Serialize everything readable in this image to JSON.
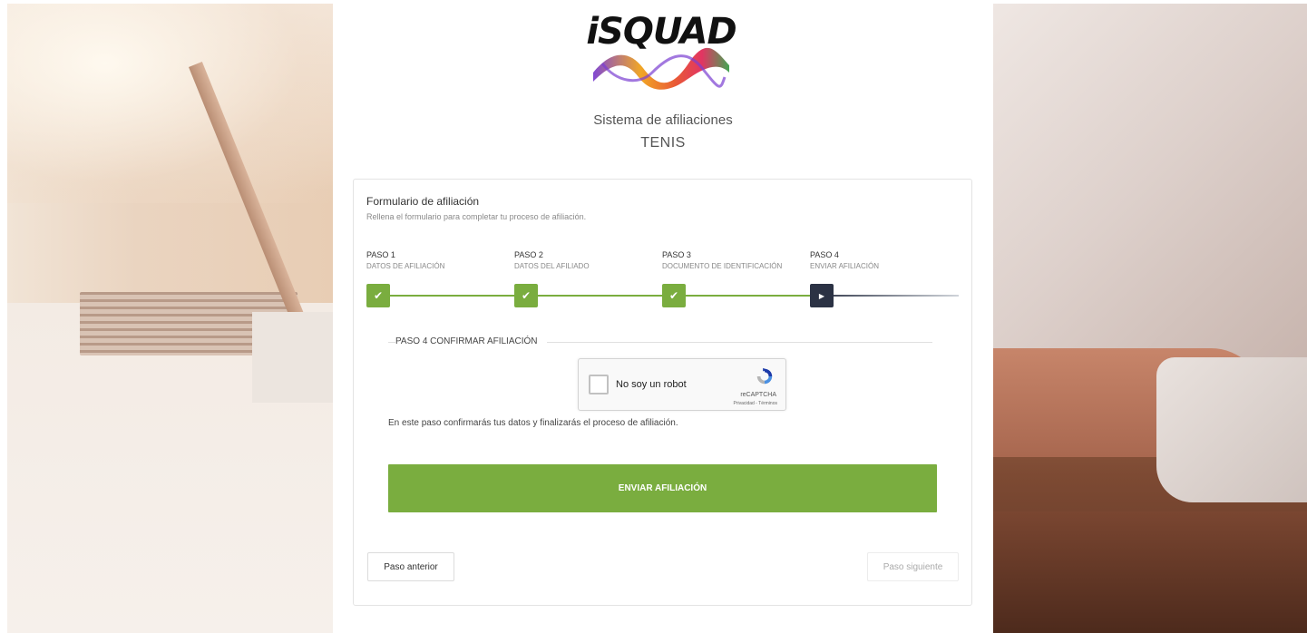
{
  "brand": {
    "logo_text": "iSQUAD"
  },
  "header": {
    "system_title": "Sistema de afiliaciones",
    "sport": "TENIS"
  },
  "form": {
    "title": "Formulario de afiliación",
    "subtitle": "Rellena el formulario para completar tu proceso de afiliación."
  },
  "steps": [
    {
      "number": "PASO 1",
      "name": "DATOS DE AFILIACIÓN",
      "status": "done",
      "icon": "check-icon"
    },
    {
      "number": "PASO 2",
      "name": "DATOS DEL AFILIADO",
      "status": "done",
      "icon": "check-icon"
    },
    {
      "number": "PASO 3",
      "name": "DOCUMENTO DE IDENTIFICACIÓN",
      "status": "done",
      "icon": "check-icon"
    },
    {
      "number": "PASO 4",
      "name": "ENVIAR AFILIACIÓN",
      "status": "active",
      "icon": "play-icon"
    }
  ],
  "section": {
    "title": "PASO 4 CONFIRMAR AFILIACIÓN"
  },
  "captcha": {
    "label": "No soy un robot",
    "brand": "reCAPTCHA",
    "links": "Privacidad - Términos"
  },
  "info_text": "En este paso confirmarás tus datos y finalizarás el proceso de afiliación.",
  "buttons": {
    "submit": "ENVIAR AFILIACIÓN",
    "previous": "Paso anterior",
    "next": "Paso siguiente"
  },
  "colors": {
    "accent_green": "#7aad3f",
    "active_step": "#2b3244"
  }
}
